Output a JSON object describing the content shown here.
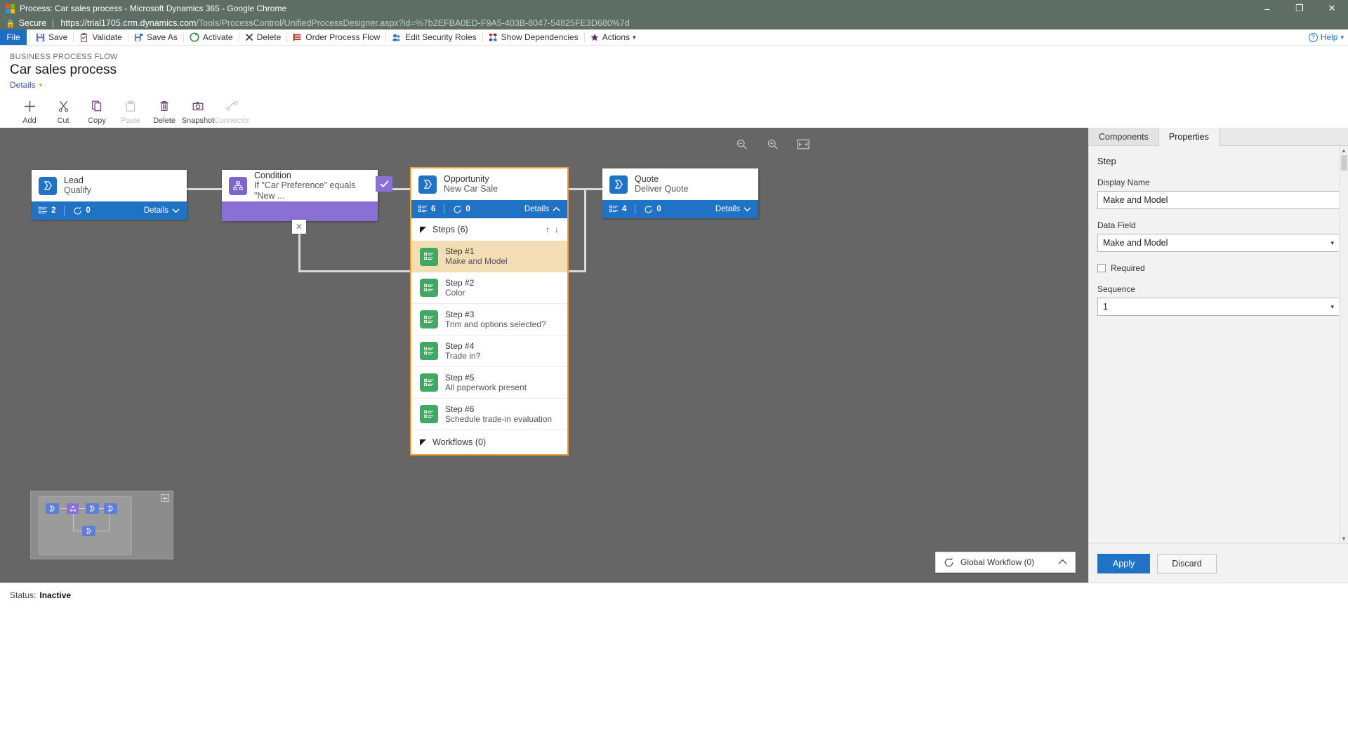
{
  "window": {
    "title": "Process: Car sales process - Microsoft Dynamics 365 - Google Chrome",
    "minimize": "–",
    "maximize": "❐",
    "close": "✕"
  },
  "address": {
    "secure_label": "Secure",
    "lock_icon": "🔒",
    "url_domain": "https://trial1705.crm.dynamics.com",
    "url_path": "/Tools/ProcessControl/UnifiedProcessDesigner.aspx?id=%7b2EFBA0ED-F9A5-403B-8047-54825FE3D680%7d"
  },
  "ribbon": {
    "file_label": "File",
    "items": [
      {
        "label": "Save",
        "icon": "save-icon"
      },
      {
        "label": "Validate",
        "icon": "validate-icon"
      },
      {
        "label": "Save As",
        "icon": "save-as-icon"
      },
      {
        "label": "Activate",
        "icon": "activate-icon"
      },
      {
        "label": "Delete",
        "icon": "delete-icon"
      },
      {
        "label": "Order Process Flow",
        "icon": "order-process-flow-icon"
      },
      {
        "label": "Edit Security Roles",
        "icon": "edit-security-roles-icon"
      },
      {
        "label": "Show Dependencies",
        "icon": "show-dependencies-icon"
      },
      {
        "label": "Actions",
        "icon": "actions-icon"
      }
    ],
    "actions_caret": "▾",
    "help_label": "Help",
    "help_caret": "▾",
    "help_mark": "?"
  },
  "page_header": {
    "kicker": "BUSINESS PROCESS FLOW",
    "title": "Car sales process",
    "details_link": "Details",
    "details_caret": "▾"
  },
  "designer_toolbar": [
    {
      "label": "Add",
      "icon": "plus-icon",
      "disabled": false
    },
    {
      "label": "Cut",
      "icon": "scissors-icon",
      "disabled": false
    },
    {
      "label": "Copy",
      "icon": "copy-icon",
      "disabled": false
    },
    {
      "label": "Paste",
      "icon": "clipboard-icon",
      "disabled": true
    },
    {
      "label": "Delete",
      "icon": "trash-icon",
      "disabled": false
    },
    {
      "label": "Snapshot",
      "icon": "camera-icon",
      "disabled": false
    },
    {
      "label": "Connector",
      "icon": "connector-icon",
      "disabled": true
    }
  ],
  "canvas": {
    "tools": [
      {
        "name": "zoom-out-icon",
        "glyph": "⊖"
      },
      {
        "name": "zoom-in-icon",
        "glyph": "⊕"
      },
      {
        "name": "fit-to-screen-icon",
        "glyph": "⛶"
      }
    ],
    "stages": [
      {
        "id": "lead",
        "title": "Lead",
        "subtitle": "Qualify",
        "icon_color": "#2072c4",
        "steps_count": "2",
        "workflows_count": "0",
        "details_label": "Details",
        "details_caret": "⌄",
        "selected": false
      },
      {
        "id": "condition",
        "title": "Condition",
        "subtitle": "If \"Car Preference\" equals \"New ...",
        "icon_color": "#7e64cb",
        "check_glyph": "✓",
        "close_glyph": "✕",
        "selected": false
      },
      {
        "id": "opportunity",
        "title": "Opportunity",
        "subtitle": "New Car Sale",
        "icon_color": "#2072c4",
        "steps_count": "6",
        "workflows_count": "0",
        "details_label": "Details",
        "details_caret": "⌃",
        "selected": true
      },
      {
        "id": "quote",
        "title": "Quote",
        "subtitle": "Deliver Quote",
        "icon_color": "#2072c4",
        "steps_count": "4",
        "workflows_count": "0",
        "details_label": "Details",
        "details_caret": "⌄",
        "selected": false
      }
    ],
    "steps_panel": {
      "header": "Steps (6)",
      "sort_up": "↑",
      "sort_down": "↓",
      "workflows_header": "Workflows (0)",
      "steps": [
        {
          "number": "Step #1",
          "name": "Make and Model",
          "active": true
        },
        {
          "number": "Step #2",
          "name": "Color",
          "active": false
        },
        {
          "number": "Step #3",
          "name": "Trim and options selected?",
          "active": false
        },
        {
          "number": "Step #4",
          "name": "Trade in?",
          "active": false
        },
        {
          "number": "Step #5",
          "name": "All paperwork present",
          "active": false
        },
        {
          "number": "Step #6",
          "name": "Schedule trade-in evaluation",
          "active": false
        }
      ]
    },
    "global_workflow": {
      "label": "Global Workflow (0)",
      "icon": "refresh-icon",
      "chevron": "⌃"
    },
    "minimap": {
      "expand_icon": "minimap-expand-icon"
    }
  },
  "right_panel": {
    "tabs": [
      {
        "label": "Components",
        "active": false
      },
      {
        "label": "Properties",
        "active": true
      }
    ],
    "section_title": "Step",
    "display_name_label": "Display Name",
    "display_name_value": "Make and Model",
    "data_field_label": "Data Field",
    "data_field_value": "Make and Model",
    "data_field_arrow": "▾",
    "required_label": "Required",
    "required_checked": false,
    "sequence_label": "Sequence",
    "sequence_value": "1",
    "sequence_arrow": "▾",
    "scroll_up": "▲",
    "scroll_down": "▼",
    "apply_label": "Apply",
    "discard_label": "Discard"
  },
  "status_bar": {
    "label": "Status:",
    "value": "Inactive"
  },
  "colors": {
    "accent_blue": "#2072c4",
    "condition_purple": "#8a6fd4",
    "step_green": "#3fa863",
    "selection_orange": "#e8a33d",
    "active_step_bg": "#f3ddb4",
    "canvas_bg": "#666666"
  }
}
